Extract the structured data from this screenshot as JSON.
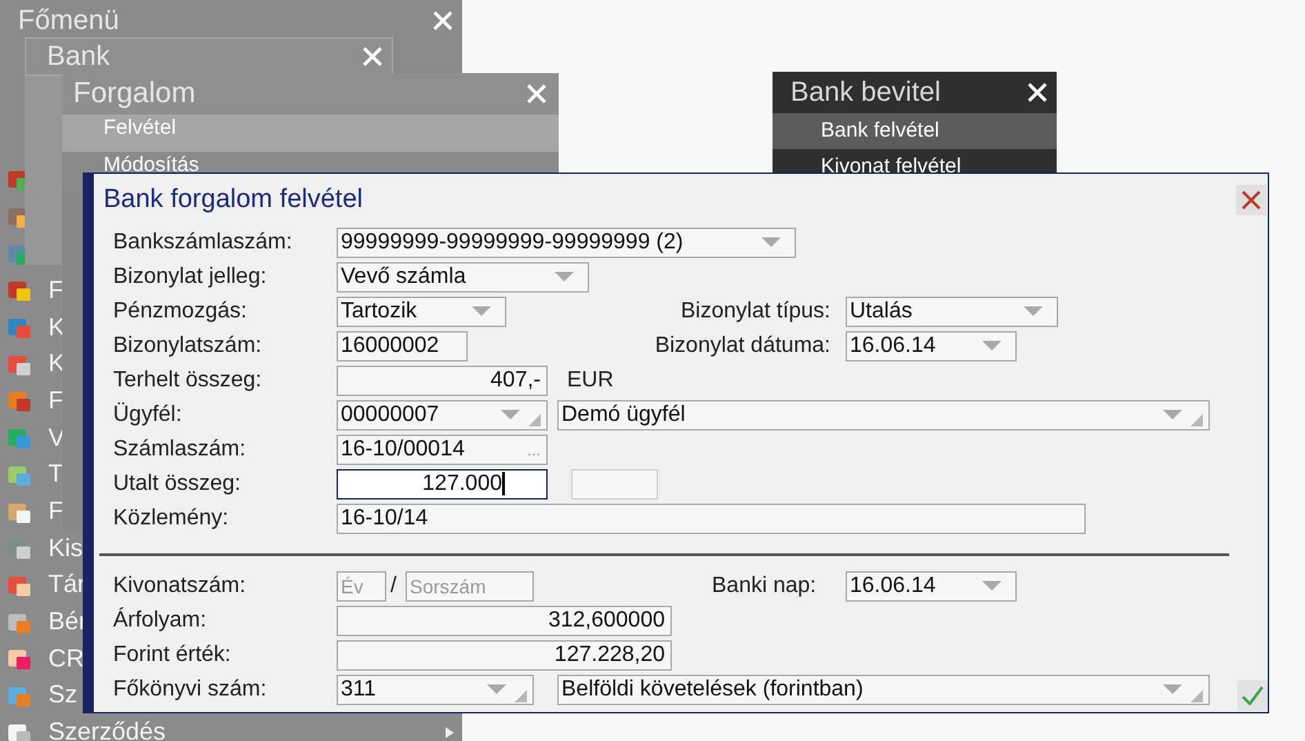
{
  "main_menu": {
    "title": "Főmenü",
    "items": [
      {
        "kind": "icon"
      },
      {
        "kind": "icon"
      },
      {
        "kind": "icon"
      },
      {
        "kind": "entry",
        "label": "F"
      },
      {
        "kind": "entry",
        "label": "K"
      },
      {
        "kind": "entry",
        "label": "K"
      },
      {
        "kind": "entry",
        "label": "F"
      },
      {
        "kind": "entry",
        "label": "V"
      },
      {
        "kind": "entry",
        "label": "T"
      },
      {
        "kind": "entry",
        "label": "F"
      },
      {
        "kind": "entry",
        "label": "Kis"
      },
      {
        "kind": "entry",
        "label": "Tár"
      },
      {
        "kind": "entry",
        "label": "Bér"
      },
      {
        "kind": "entry",
        "label": "CR"
      },
      {
        "kind": "entry",
        "label": "Sz"
      },
      {
        "kind": "entry",
        "label": "Szerződés",
        "has_submenu": true
      }
    ]
  },
  "bank_menu": {
    "title": "Bank"
  },
  "forgalom_menu": {
    "title": "Forgalom",
    "items": [
      {
        "label": "Felvétel",
        "selected": true
      },
      {
        "label": "Módosítás",
        "selected": false
      }
    ]
  },
  "bank_bevitel_menu": {
    "title": "Bank bevitel",
    "items": [
      {
        "label": "Bank felvétel",
        "selected": true
      },
      {
        "label": "Kivonat felvétel",
        "selected": false
      }
    ]
  },
  "dialog": {
    "title": "Bank forgalom felvétel",
    "rows": [
      {
        "label": "Bankszámlaszám:",
        "items": [
          {
            "kind": "dropdown",
            "value": "99999999-99999999-99999999 (2)"
          }
        ]
      },
      {
        "label": "Bizonylat jelleg:",
        "items": [
          {
            "kind": "dropdown",
            "value": "Vevő számla"
          }
        ]
      },
      {
        "label": "Pénzmozgás:",
        "items": [
          {
            "kind": "dropdown",
            "value": "Tartozik"
          },
          {
            "kind": "caption",
            "text": "Bizonylat típus:"
          },
          {
            "kind": "dropdown",
            "value": "Utalás"
          }
        ]
      },
      {
        "label": "Bizonylatszám:",
        "items": [
          {
            "kind": "text",
            "value": "16000002"
          },
          {
            "kind": "caption",
            "text": "Bizonylat dátuma:"
          },
          {
            "kind": "dropdown",
            "value": "16.06.14"
          }
        ]
      },
      {
        "label": "Terhelt összeg:",
        "items": [
          {
            "kind": "number",
            "value": "407,-"
          },
          {
            "kind": "unit",
            "text": "EUR"
          }
        ]
      },
      {
        "label": "Ügyfél:",
        "items": [
          {
            "kind": "lookup",
            "value": "00000007"
          },
          {
            "kind": "lookup",
            "value": "Demó ügyfél"
          }
        ]
      },
      {
        "label": "Számlaszám:",
        "items": [
          {
            "kind": "browse",
            "value": "16-10/00014",
            "button": "..."
          }
        ]
      },
      {
        "label": "Utalt összeg:",
        "items": [
          {
            "kind": "number",
            "value": "127.000",
            "focused": true
          },
          {
            "kind": "empty"
          }
        ]
      },
      {
        "label": "Közlemény:",
        "items": [
          {
            "kind": "text",
            "value": "16-10/14"
          }
        ]
      }
    ],
    "lower_rows": [
      {
        "label": "Kivonatszám:",
        "items": [
          {
            "kind": "input",
            "placeholder": "Év"
          },
          {
            "kind": "unit",
            "text": "/"
          },
          {
            "kind": "input",
            "placeholder": "Sorszám"
          },
          {
            "kind": "unit",
            "text": "Banki nap:"
          },
          {
            "kind": "dropdown",
            "value": "16.06.14"
          }
        ]
      },
      {
        "label": "Árfolyam:",
        "items": [
          {
            "kind": "number",
            "value": "312,600000"
          }
        ]
      },
      {
        "label": "Forint érték:",
        "items": [
          {
            "kind": "number",
            "value": "127.228,20"
          }
        ]
      },
      {
        "label": "Főkönyvi szám:",
        "items": [
          {
            "kind": "lookup",
            "value": "311"
          },
          {
            "kind": "lookup",
            "value": "Belföldi követelések (forintban)"
          },
          {
            "kind": "confirm"
          }
        ]
      }
    ]
  }
}
